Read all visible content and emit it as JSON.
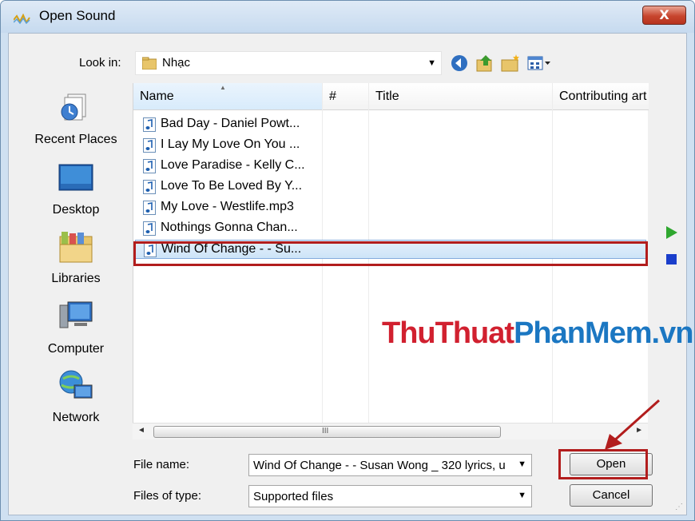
{
  "window": {
    "title": "Open Sound",
    "close_label": "X"
  },
  "look_in": {
    "label": "Look in:",
    "value": "Nhạc"
  },
  "toolbar": {
    "icons": [
      "back-icon",
      "up-folder-icon",
      "new-folder-icon",
      "view-menu-icon"
    ]
  },
  "places": [
    {
      "label": "Recent Places",
      "icon": "recent-places-icon"
    },
    {
      "label": "Desktop",
      "icon": "desktop-icon"
    },
    {
      "label": "Libraries",
      "icon": "libraries-icon"
    },
    {
      "label": "Computer",
      "icon": "computer-icon"
    },
    {
      "label": "Network",
      "icon": "network-icon"
    }
  ],
  "columns": [
    "Name",
    "#",
    "Title",
    "Contributing art"
  ],
  "files": [
    "Bad Day - Daniel Powt...",
    "I Lay My Love On You ...",
    "Love Paradise - Kelly C...",
    "Love To Be Loved By Y...",
    "My Love - Westlife.mp3",
    "Nothings Gonna Chan...",
    "Wind Of Change - - Su..."
  ],
  "selected_index": 6,
  "scrollbar": {
    "grip": "III"
  },
  "watermark": {
    "part1": "ThuThuat",
    "part2": "PhanMem.vn"
  },
  "file_name": {
    "label": "File name:",
    "value": "Wind Of Change - - Susan Wong _ 320 lyrics, u"
  },
  "file_type": {
    "label": "Files of type:",
    "value": "Supported files"
  },
  "buttons": {
    "open": "Open",
    "cancel": "Cancel"
  },
  "colors": {
    "highlight": "#b21d1d",
    "play": "#2fa72f",
    "stop": "#1a3ecb"
  }
}
